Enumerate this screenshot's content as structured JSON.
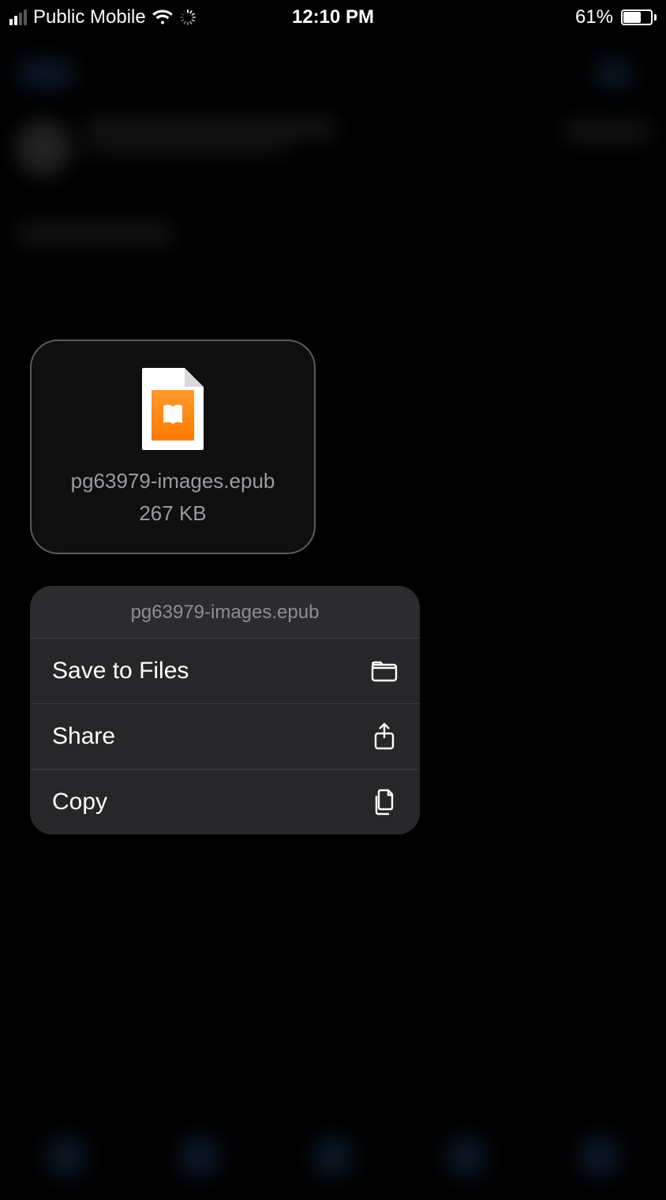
{
  "status": {
    "carrier": "Public Mobile",
    "time": "12:10 PM",
    "battery_percent": "61%"
  },
  "file": {
    "name": "pg63979-images.epub",
    "size": "267 KB"
  },
  "menu": {
    "header": "pg63979-images.epub",
    "save": "Save to Files",
    "share": "Share",
    "copy": "Copy"
  }
}
